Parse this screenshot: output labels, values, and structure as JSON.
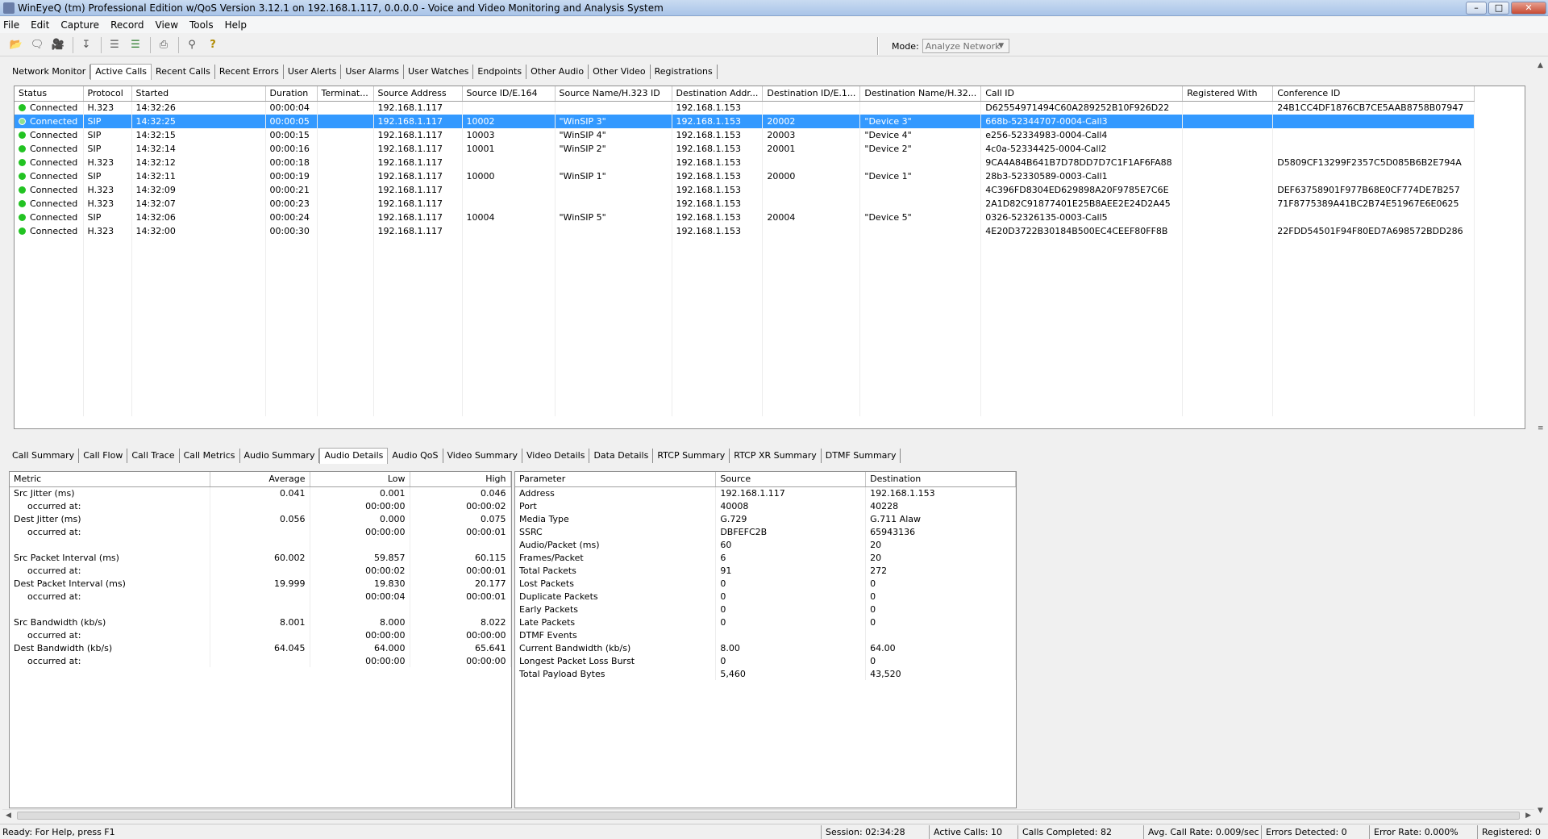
{
  "window": {
    "title": "WinEyeQ (tm) Professional Edition w/QoS Version 3.12.1 on 192.168.1.117, 0.0.0.0 - Voice and Video Monitoring and Analysis System"
  },
  "menu": [
    "File",
    "Edit",
    "Capture",
    "Record",
    "View",
    "Tools",
    "Help"
  ],
  "toolbar": {
    "buttons": [
      "open-icon",
      "comment-icon",
      "camera-icon",
      "download-icon",
      "stack-icon",
      "stack-color-icon",
      "printer-icon",
      "search-icon",
      "help-icon"
    ],
    "mode_label": "Mode:",
    "mode_value": "Analyze Network"
  },
  "top_tabs": [
    "Network Monitor",
    "Active Calls",
    "Recent Calls",
    "Recent Errors",
    "User Alerts",
    "User Alarms",
    "User Watches",
    "Endpoints",
    "Other Audio",
    "Other Video",
    "Registrations"
  ],
  "top_active": 1,
  "calls": {
    "columns": [
      "Status",
      "Protocol",
      "Started",
      "Duration",
      "Terminat...",
      "Source Address",
      "Source ID/E.164",
      "Source Name/H.323 ID",
      "Destination Addr...",
      "Destination ID/E.1...",
      "Destination Name/H.32...",
      "Call ID",
      "Registered With",
      "Conference ID"
    ],
    "selected_row": 1,
    "rows": [
      [
        "Connected",
        "H.323",
        "14:32:26",
        "00:00:04",
        "",
        "192.168.1.117",
        "",
        "",
        "192.168.1.153",
        "",
        "",
        "D62554971494C60A289252B10F926D22",
        "",
        "24B1CC4DF1876CB7CE5AAB8758B07947"
      ],
      [
        "Connected",
        "SIP",
        "14:32:25",
        "00:00:05",
        "",
        "192.168.1.117",
        "10002",
        "\"WinSIP 3\"",
        "192.168.1.153",
        "20002",
        "\"Device 3\"",
        "668b-52344707-0004-Call3",
        "",
        ""
      ],
      [
        "Connected",
        "SIP",
        "14:32:15",
        "00:00:15",
        "",
        "192.168.1.117",
        "10003",
        "\"WinSIP 4\"",
        "192.168.1.153",
        "20003",
        "\"Device 4\"",
        "e256-52334983-0004-Call4",
        "",
        ""
      ],
      [
        "Connected",
        "SIP",
        "14:32:14",
        "00:00:16",
        "",
        "192.168.1.117",
        "10001",
        "\"WinSIP 2\"",
        "192.168.1.153",
        "20001",
        "\"Device 2\"",
        "4c0a-52334425-0004-Call2",
        "",
        ""
      ],
      [
        "Connected",
        "H.323",
        "14:32:12",
        "00:00:18",
        "",
        "192.168.1.117",
        "",
        "",
        "192.168.1.153",
        "",
        "",
        "9CA4A84B641B7D78DD7D7C1F1AF6FA88",
        "",
        "D5809CF13299F2357C5D085B6B2E794A"
      ],
      [
        "Connected",
        "SIP",
        "14:32:11",
        "00:00:19",
        "",
        "192.168.1.117",
        "10000",
        "\"WinSIP 1\"",
        "192.168.1.153",
        "20000",
        "\"Device 1\"",
        "28b3-52330589-0003-Call1",
        "",
        ""
      ],
      [
        "Connected",
        "H.323",
        "14:32:09",
        "00:00:21",
        "",
        "192.168.1.117",
        "",
        "",
        "192.168.1.153",
        "",
        "",
        "4C396FD8304ED629898A20F9785E7C6E",
        "",
        "DEF63758901F977B68E0CF774DE7B257"
      ],
      [
        "Connected",
        "H.323",
        "14:32:07",
        "00:00:23",
        "",
        "192.168.1.117",
        "",
        "",
        "192.168.1.153",
        "",
        "",
        "2A1D82C91877401E25B8AEE2E24D2A45",
        "",
        "71F8775389A41BC2B74E51967E6E0625"
      ],
      [
        "Connected",
        "SIP",
        "14:32:06",
        "00:00:24",
        "",
        "192.168.1.117",
        "10004",
        "\"WinSIP 5\"",
        "192.168.1.153",
        "20004",
        "\"Device 5\"",
        "0326-52326135-0003-Call5",
        "",
        ""
      ],
      [
        "Connected",
        "H.323",
        "14:32:00",
        "00:00:30",
        "",
        "192.168.1.117",
        "",
        "",
        "192.168.1.153",
        "",
        "",
        "4E20D3722B30184B500EC4CEEF80FF8B",
        "",
        "22FDD54501F94F80ED7A698572BDD286"
      ]
    ]
  },
  "bottom_tabs": [
    "Call Summary",
    "Call Flow",
    "Call Trace",
    "Call Metrics",
    "Audio Summary",
    "Audio Details",
    "Audio QoS",
    "Video Summary",
    "Video Details",
    "Data Details",
    "RTCP Summary",
    "RTCP XR Summary",
    "DTMF Summary"
  ],
  "bottom_active": 5,
  "metrics": {
    "columns": [
      "Metric",
      "Average",
      "Low",
      "High"
    ],
    "rows": [
      [
        "Src  Jitter (ms)",
        "0.041",
        "0.001",
        "0.046"
      ],
      [
        "occurred at:",
        "",
        "00:00:00",
        "00:00:02"
      ],
      [
        "Dest Jitter (ms)",
        "0.056",
        "0.000",
        "0.075"
      ],
      [
        "occurred at:",
        "",
        "00:00:00",
        "00:00:01"
      ],
      [
        "",
        "",
        "",
        ""
      ],
      [
        "Src  Packet Interval (ms)",
        "60.002",
        "59.857",
        "60.115"
      ],
      [
        "occurred at:",
        "",
        "00:00:02",
        "00:00:01"
      ],
      [
        "Dest Packet Interval (ms)",
        "19.999",
        "19.830",
        "20.177"
      ],
      [
        "occurred at:",
        "",
        "00:00:04",
        "00:00:01"
      ],
      [
        "",
        "",
        "",
        ""
      ],
      [
        "Src  Bandwidth (kb/s)",
        "8.001",
        "8.000",
        "8.022"
      ],
      [
        "occurred at:",
        "",
        "00:00:00",
        "00:00:00"
      ],
      [
        "Dest Bandwidth (kb/s)",
        "64.045",
        "64.000",
        "65.641"
      ],
      [
        "occurred at:",
        "",
        "00:00:00",
        "00:00:00"
      ]
    ]
  },
  "params": {
    "columns": [
      "Parameter",
      "Source",
      "Destination"
    ],
    "rows": [
      [
        "Address",
        "192.168.1.117",
        "192.168.1.153"
      ],
      [
        "Port",
        "40008",
        "40228"
      ],
      [
        "Media Type",
        "G.729",
        "G.711 Alaw"
      ],
      [
        "SSRC",
        "DBFEFC2B",
        "65943136"
      ],
      [
        "Audio/Packet (ms)",
        "60",
        "20"
      ],
      [
        "Frames/Packet",
        "6",
        "20"
      ],
      [
        "Total Packets",
        "91",
        "272"
      ],
      [
        "Lost Packets",
        "0",
        "0"
      ],
      [
        "Duplicate Packets",
        "0",
        "0"
      ],
      [
        "Early Packets",
        "0",
        "0"
      ],
      [
        "Late Packets",
        "0",
        "0"
      ],
      [
        "DTMF Events",
        "",
        ""
      ],
      [
        "Current Bandwidth (kb/s)",
        "8.00",
        "64.00"
      ],
      [
        "Longest Packet Loss Burst",
        "0",
        "0"
      ],
      [
        "Total Payload Bytes",
        "5,460",
        "43,520"
      ]
    ]
  },
  "status": {
    "ready": "Ready: For Help, press F1",
    "cells": [
      "Session: 02:34:28",
      "Active Calls: 10",
      "Calls Completed: 82",
      "Avg. Call Rate: 0.009/sec",
      "Errors Detected: 0",
      "Error Rate: 0.000%",
      "Registered: 0"
    ]
  }
}
